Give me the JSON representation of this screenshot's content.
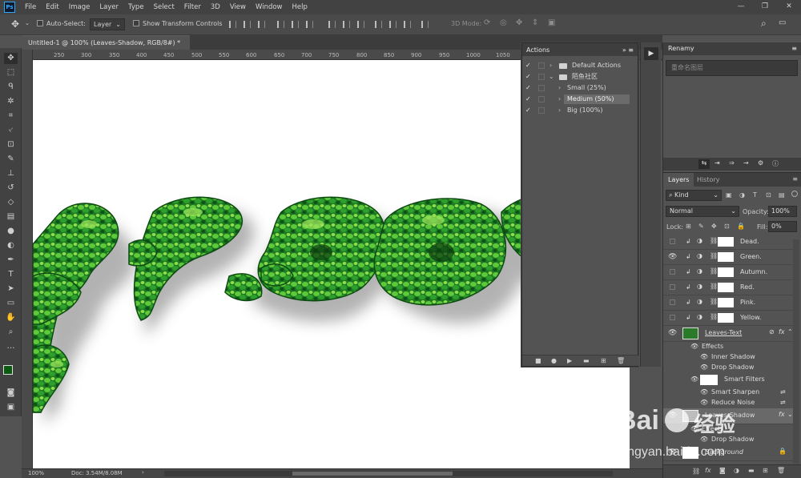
{
  "menu": [
    "File",
    "Edit",
    "Image",
    "Layer",
    "Type",
    "Select",
    "Filter",
    "3D",
    "View",
    "Window",
    "Help"
  ],
  "app_logo": "Ps",
  "window_controls": [
    "—",
    "❐",
    "✕"
  ],
  "options": {
    "auto_select_label": "Auto-Select:",
    "auto_select_value": "Layer",
    "show_transform_label": "Show Transform Controls",
    "mode_3d_label": "3D Mode:"
  },
  "doc_tab": {
    "title": "Untitled-1 @ 100% (Leaves-Shadow, RGB/8#) *",
    "close": "×"
  },
  "ruler_labels": [
    "250",
    "300",
    "350",
    "400",
    "450",
    "500",
    "550",
    "600",
    "650",
    "700",
    "750",
    "800",
    "850",
    "900",
    "950",
    "1000",
    "1050"
  ],
  "status": {
    "zoom": "100%",
    "doc": "Doc: 3.54M/8.08M",
    "arrow": "›"
  },
  "actions": {
    "title": "Actions",
    "rows": [
      {
        "label": "Default Actions",
        "checked": true,
        "expanded": false,
        "folder": true
      },
      {
        "label": "陌鱼社区",
        "checked": true,
        "expanded": true,
        "folder": true
      },
      {
        "label": "Small (25%)",
        "checked": true,
        "expanded": false,
        "folder": false
      },
      {
        "label": "Medium (50%)",
        "checked": true,
        "expanded": false,
        "folder": false,
        "selected": true
      },
      {
        "label": "Big (100%)",
        "checked": true,
        "expanded": false,
        "folder": false
      }
    ]
  },
  "renamy": {
    "title": "Renamy",
    "placeholder": "重命名图层"
  },
  "layers_panel": {
    "tabs": [
      "Layers",
      "History"
    ],
    "kind_label": "Kind",
    "blend_mode": "Normal",
    "opacity_label": "Opacity:",
    "opacity_value": "100%",
    "lock_label": "Lock:",
    "fill_label": "Fill:",
    "fill_value": "0%",
    "layers": [
      {
        "name": "Dead.",
        "visible": false
      },
      {
        "name": "Green.",
        "visible": true
      },
      {
        "name": "Autumn.",
        "visible": false
      },
      {
        "name": "Red.",
        "visible": false
      },
      {
        "name": "Pink.",
        "visible": false
      },
      {
        "name": "Yellow.",
        "visible": false
      }
    ],
    "leaves_text": {
      "name": "Leaves-Text",
      "fx": "fx",
      "effects_label": "Effects",
      "effects": [
        "Inner Shadow",
        "Drop Shadow"
      ],
      "smart_filters_label": "Smart Filters",
      "smart_filters": [
        "Smart Sharpen",
        "Reduce Noise"
      ]
    },
    "leaves_shadow": {
      "name": "Leaves-Shadow",
      "fx": "fx",
      "effects_label": "Effects",
      "effects": [
        "Drop Shadow"
      ]
    },
    "background": {
      "name": "Background"
    }
  },
  "watermark": {
    "brand": "Bai",
    "brand2": "经验",
    "url": "jingyan.baidu.com"
  },
  "colors": {
    "accent": "#31a8ff",
    "leaf_dark": "#0d4a12",
    "leaf_mid": "#1f8a2a",
    "leaf_light": "#6fcf3a"
  }
}
